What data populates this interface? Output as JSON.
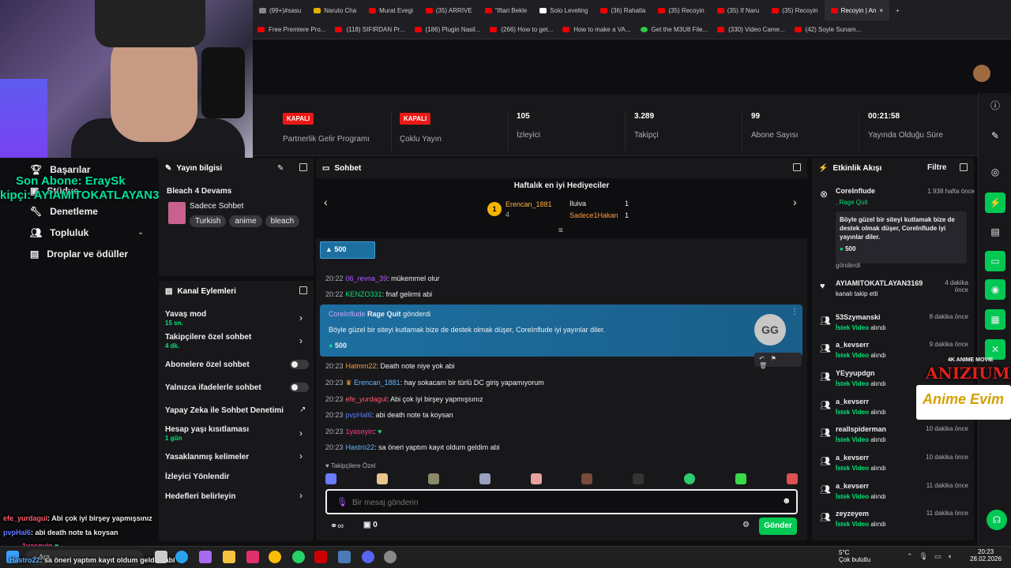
{
  "browser": {
    "tabs": [
      "(99+)#sasu",
      "Naruto Cha",
      "Murat Evegi",
      "(35) ARRIVE",
      "\"Iftari Bekle",
      "Solo Leveling",
      "(36) Rahatla",
      "(35) Recoyin",
      "(35) If Naru",
      "(35) Recoyin",
      "Recoyin | An"
    ],
    "bookmarks": [
      "Free Premiere Pro...",
      "(118) SIFIRDAN Pr...",
      "(186) Plugin Nasil...",
      "(266) How to get...",
      "How to make a VA...",
      "Get the M3U8 File...",
      "(330) Video Came...",
      "(42) Soyle Sunam..."
    ]
  },
  "stats": [
    {
      "badge": "KAPALI",
      "label": "Partnerlik Gelir Programı"
    },
    {
      "badge": "KAPALI",
      "label": "Çoklu Yayın"
    },
    {
      "value": "105",
      "label": "İzleyici"
    },
    {
      "value": "3.289",
      "label": "Takipçi"
    },
    {
      "value": "99",
      "label": "Abone Sayısı"
    },
    {
      "value": "00:21:58",
      "label": "Yayında Olduğu Süre"
    }
  ],
  "leftnav": {
    "items": [
      "Başarılar",
      "Stüdyo",
      "Denetleme",
      "Topluluk",
      "Droplar ve ödüller"
    ]
  },
  "overlays": {
    "sub_alert": "Son Abone: EraySk",
    "follow_alert": "kipçi: AYIAMITOKATLAYAN3169",
    "chat1_user": "efe_yurdagul",
    "chat1_text": ": Abi çok iyi birşey yapmışsınız",
    "chat2_user": "pvpHal6",
    "chat2_text": ": abi death note ta koysan",
    "chat3_user": "Hastro22",
    "chat3_text": ": sa öneri yaptım kayıt oldum geldim abi",
    "chat4_user": "1yasoyin",
    "search_text": "Ara"
  },
  "stream_info": {
    "title": "Yayın bilgisi",
    "stream_title": "Bleach 4 Devams",
    "category": "Sadece Sohbet",
    "tags": [
      "Turkish",
      "anime",
      "bleach"
    ]
  },
  "channel_actions": {
    "title": "Kanal Eylemleri",
    "items": [
      {
        "label": "Yavaş mod",
        "sub": "15 sn."
      },
      {
        "label": "Takipçilere özel sohbet",
        "sub": "4 dk."
      },
      {
        "label": "Abonelere özel sohbet"
      },
      {
        "label": "Yalnızca ifadelerle sohbet"
      },
      {
        "label": "Yapay Zeka ile Sohbet Denetimi"
      },
      {
        "label": "Hesap yaşı kısıtlaması",
        "sub": "1 gün"
      },
      {
        "label": "Yasaklanmış kelimeler"
      },
      {
        "label": "İzleyici Yönlendir"
      },
      {
        "label": "Hedefleri belirleyin"
      }
    ]
  },
  "chat": {
    "title": "Sohbet",
    "gifters_title": "Haftalık en iyi Hediyeciler",
    "gifter1_name": "Erencan_1881",
    "gifter1_count": "1",
    "gifter1_sub": "4",
    "gifter2_name": "Iluiva",
    "gifter2_count": "1",
    "gifter3_name": "Sadece1Hakan",
    "gifter3_count": "1",
    "pinned_amount": "500",
    "messages": [
      {
        "time": "20:22",
        "user": "06_revna_39",
        "text": ": mükemmel olur",
        "color": "#b15cff"
      },
      {
        "time": "20:22",
        "user": "KENZO331",
        "text": ": fnaf gelirmi abi",
        "color": "#00e676"
      },
      {
        "time": "20:23",
        "user": "Hatmm22",
        "text": ": Death note niye yok abi",
        "color": "#ff9a3c"
      },
      {
        "time": "20:23",
        "user": "Erencan_1881",
        "text": ": hay sokacam bir türlü DC giriş yapamıyorum",
        "color": "#5fb6ff"
      },
      {
        "time": "20:23",
        "user": "efe_yurdagul",
        "text": ": Abi çok iyi birşey yapmışsınız",
        "color": "#ff5a6e"
      },
      {
        "time": "20:23",
        "user": "pvpHal6",
        "text": ": abi death note ta koysan",
        "color": "#5f7bff"
      },
      {
        "time": "20:23",
        "user": "1yasoyin",
        "text": ":",
        "color": "#ff3b8e"
      },
      {
        "time": "20:23",
        "user": "Hastro22",
        "text": ": sa öneri yaptım kayıt oldum geldim abi",
        "color": "#5fb6ff"
      }
    ],
    "highlight": {
      "user": "CoreInflude",
      "item": "Rage Quit",
      "action": "gönderdi",
      "text": "Böyle güzel bir siteyi kutlamak bize de destek olmak düşer, CoreInflude iyi yayınlar diler.",
      "amount": "500"
    },
    "followers_only": "Takipçilere Özel",
    "input_placeholder": "Bir mesaj gönderin",
    "points": "0",
    "send_label": "Gönder"
  },
  "activity": {
    "title": "Etkinlik Akışı",
    "filter_label": "Filtre",
    "top": {
      "name": "CoreInflude",
      "ago": "1.938 hafta önce",
      "item": ", Rage Quit",
      "text": "Böyle güzel bir siteyi kutlamak bize de destek olmak düşer, CoreInflude iyi yayınlar diler.",
      "amount": "500",
      "sent": "gönderdi"
    },
    "events": [
      {
        "name": "AYIAMITOKATLAYAN3169",
        "what": "kanalı takip etti",
        "ago": "4 dakika önce",
        "icon": "heart"
      },
      {
        "name": "53Szymanski",
        "what": "İstek Video",
        "suffix": "alındı",
        "ago": "8 dakika önce",
        "icon": "users"
      },
      {
        "name": "a_kevserr",
        "what": "İstek Video",
        "suffix": "alındı",
        "ago": "9 dakika önce",
        "icon": "users"
      },
      {
        "name": "YEyyupdgn",
        "what": "İstek Video",
        "suffix": "alındı",
        "ago": "",
        "icon": "users"
      },
      {
        "name": "a_kevserr",
        "what": "İstek Video",
        "suffix": "alındı",
        "ago": "",
        "icon": "users"
      },
      {
        "name": "reallspiderman",
        "what": "İstek Video",
        "suffix": "alındı",
        "ago": "10 dakika önce",
        "icon": "users"
      },
      {
        "name": "a_kevserr",
        "what": "İstek Video",
        "suffix": "alındı",
        "ago": "10 dakika önce",
        "icon": "users"
      },
      {
        "name": "a_kevserr",
        "what": "İstek Video",
        "suffix": "alındı",
        "ago": "11 dakika önce",
        "icon": "users"
      },
      {
        "name": "zeyzeyem",
        "what": "İstek Video",
        "suffix": "alındı",
        "ago": "11 dakika önce",
        "icon": "users"
      }
    ]
  },
  "ads": {
    "logo1": "ANIZIUM",
    "logo1_sub": "4K ANIME MOVIE",
    "logo2": "Anime Evim"
  },
  "taskbar": {
    "weather_temp": "5°C",
    "weather_desc": "Çok bulutlu",
    "time": "20:23",
    "date": "28.02.2026"
  }
}
